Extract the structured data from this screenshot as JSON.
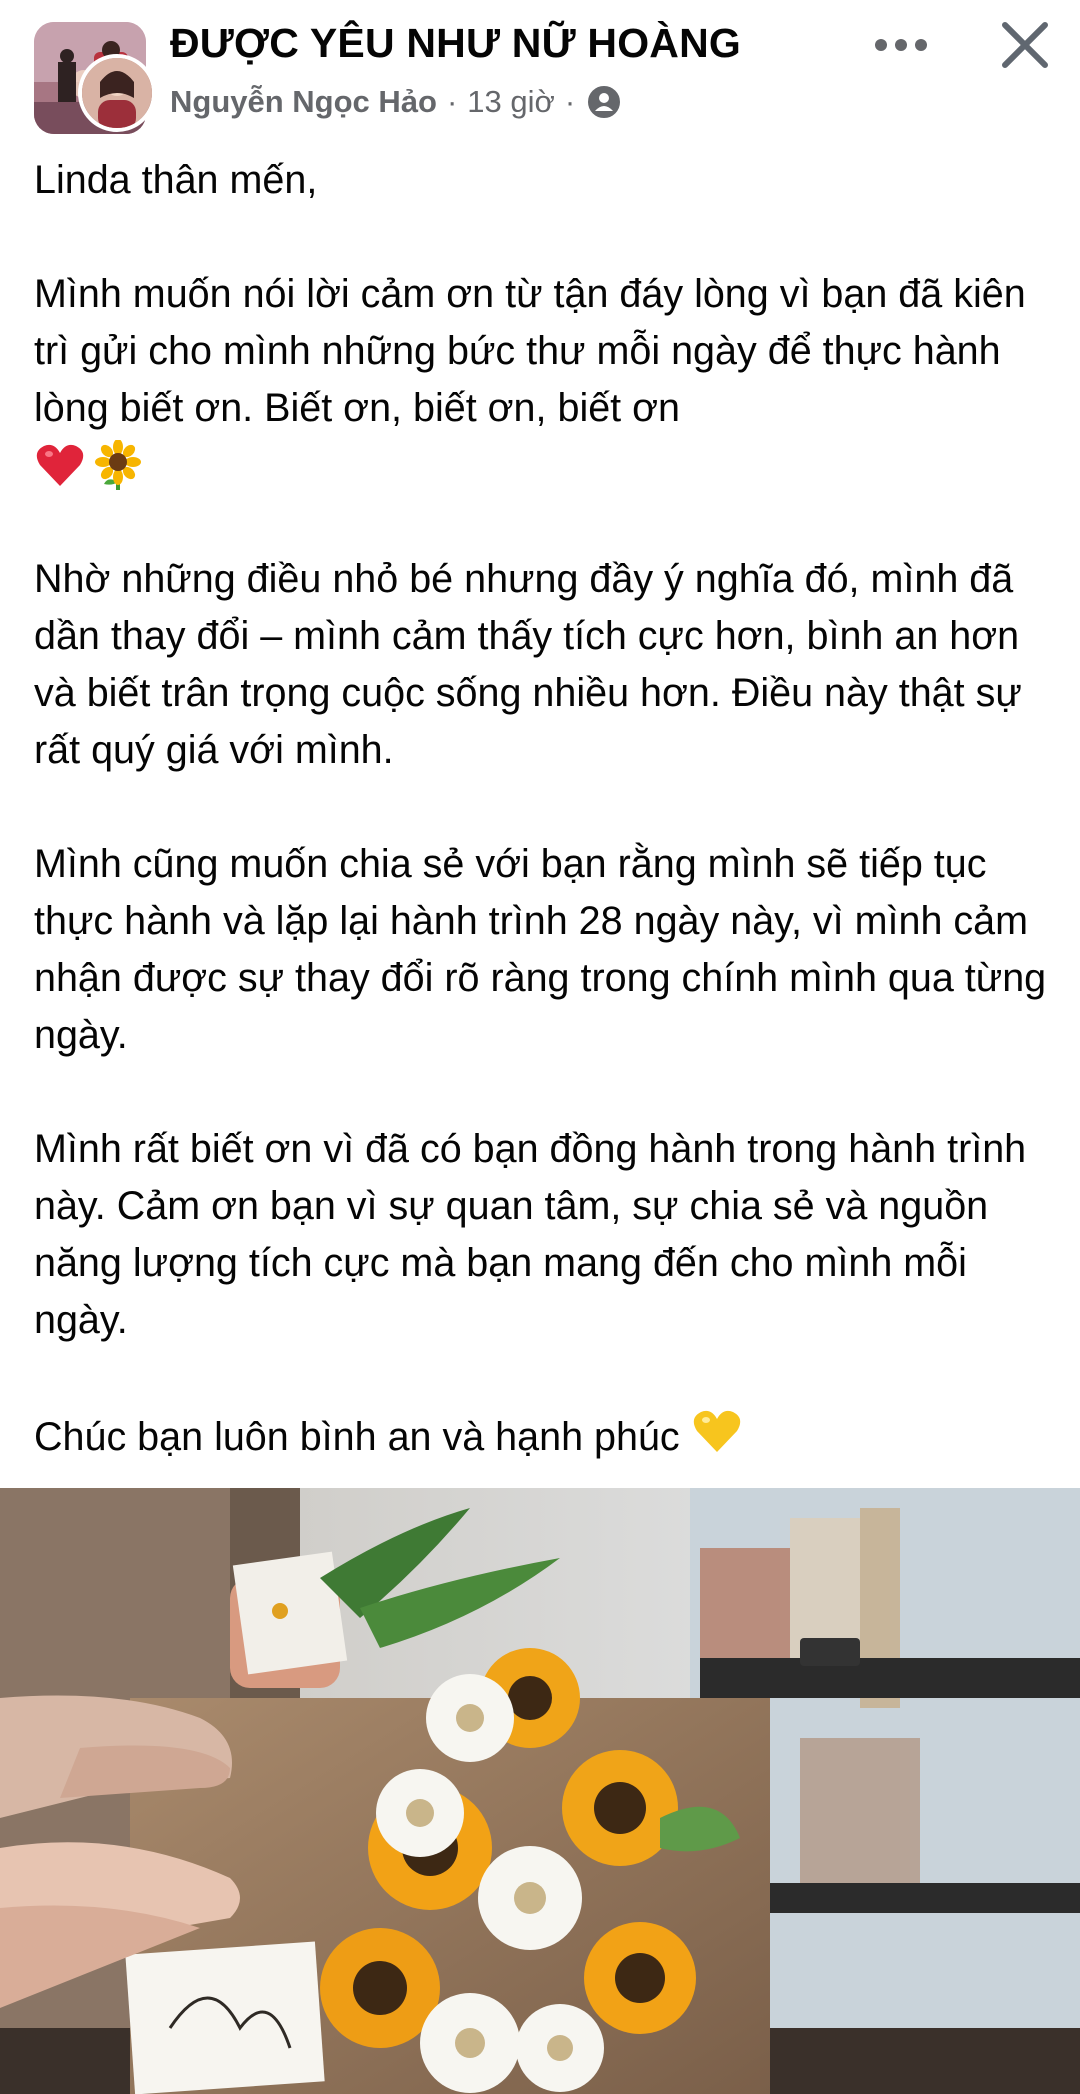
{
  "header": {
    "group_name": "ĐƯỢC YÊU NHƯ NỮ HOÀNG",
    "author": "Nguyễn Ngọc Hảo",
    "separator": "·",
    "time": "13 giờ",
    "audience_icon": "public-globe-icon",
    "more_icon": "more-options-icon",
    "close_icon": "close-icon"
  },
  "post": {
    "greeting": "Linda thân mến,",
    "paragraph_1": "Mình muốn nói lời cảm ơn từ tận đáy lòng vì bạn đã kiên trì gửi cho mình những bức thư mỗi ngày để thực hành lòng biết ơn. Biết ơn, biết ơn, biết ơn",
    "paragraph_1_emojis": [
      "red-heart-emoji",
      "sunflower-emoji"
    ],
    "paragraph_2": "Nhờ những điều nhỏ bé nhưng đầy ý nghĩa đó, mình đã dần thay đổi – mình cảm thấy tích cực hơn, bình an hơn và biết trân trọng cuộc sống nhiều hơn. Điều này thật sự rất quý giá với mình.",
    "paragraph_3": "Mình cũng muốn chia sẻ với bạn rằng mình sẽ tiếp tục thực hành và lặp lại hành trình 28 ngày này, vì mình cảm nhận được sự thay đổi rõ ràng trong chính mình qua từng ngày.",
    "paragraph_4": "Mình rất biết ơn vì đã có bạn đồng hành trong hành trình này. Cảm ơn bạn vì sự quan tâm, sự chia sẻ và nguồn năng lượng tích cực mà bạn mang đến cho mình mỗi ngày.",
    "closing": "Chúc bạn luôn bình an và hạnh phúc",
    "closing_emoji": "yellow-heart-emoji"
  },
  "photo": {
    "subject": "bouquet of sunflowers and white gerberas with a thank-you card"
  },
  "colors": {
    "text": "#050505",
    "secondary": "#65676b",
    "heart_red": "#e0243a",
    "heart_yellow": "#f7c51e"
  }
}
